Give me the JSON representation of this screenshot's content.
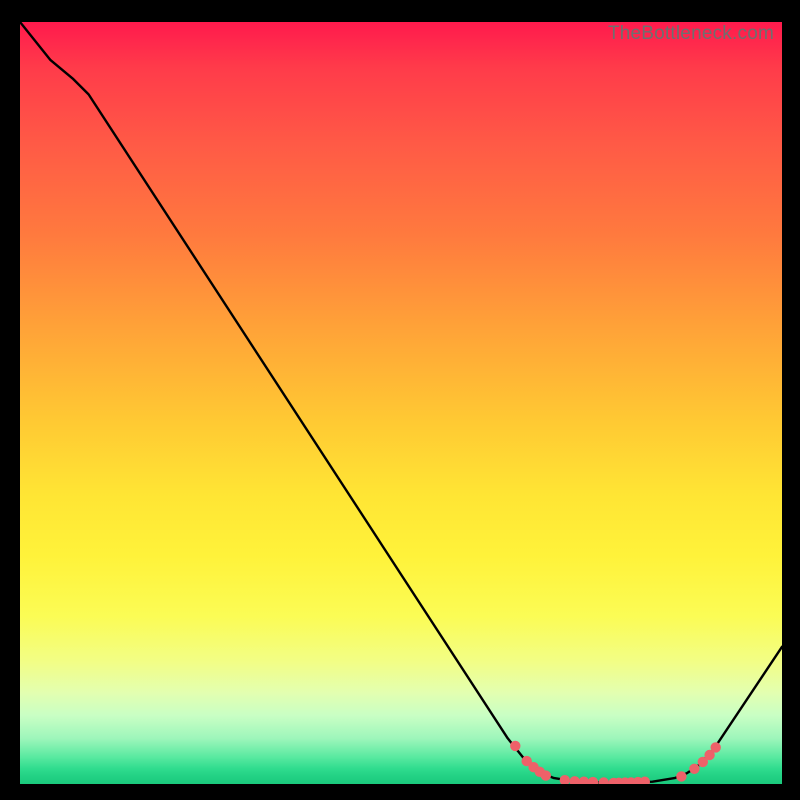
{
  "watermark": "TheBottleneck.com",
  "chart_data": {
    "type": "line",
    "title": "",
    "xlabel": "",
    "ylabel": "",
    "xlim": [
      0,
      100
    ],
    "ylim": [
      0,
      100
    ],
    "background_metric": "bottleneck_severity_gradient_red_to_green",
    "curve": [
      {
        "x": 0,
        "y": 100
      },
      {
        "x": 4,
        "y": 95
      },
      {
        "x": 7,
        "y": 92.5
      },
      {
        "x": 9,
        "y": 90.5
      },
      {
        "x": 64,
        "y": 6
      },
      {
        "x": 66,
        "y": 3.5
      },
      {
        "x": 67,
        "y": 2.6
      },
      {
        "x": 68,
        "y": 1.8
      },
      {
        "x": 69,
        "y": 1.2
      },
      {
        "x": 70,
        "y": 0.8
      },
      {
        "x": 73,
        "y": 0.3
      },
      {
        "x": 78,
        "y": 0.15
      },
      {
        "x": 83,
        "y": 0.3
      },
      {
        "x": 86,
        "y": 0.8
      },
      {
        "x": 87.5,
        "y": 1.4
      },
      {
        "x": 89,
        "y": 2.4
      },
      {
        "x": 91,
        "y": 4.5
      },
      {
        "x": 100,
        "y": 18
      }
    ],
    "markers": [
      {
        "x": 65.0,
        "y": 5.0
      },
      {
        "x": 66.5,
        "y": 3.0
      },
      {
        "x": 67.4,
        "y": 2.2
      },
      {
        "x": 68.2,
        "y": 1.6
      },
      {
        "x": 69.0,
        "y": 1.1
      },
      {
        "x": 71.5,
        "y": 0.5
      },
      {
        "x": 72.8,
        "y": 0.35
      },
      {
        "x": 74.0,
        "y": 0.3
      },
      {
        "x": 75.2,
        "y": 0.25
      },
      {
        "x": 76.6,
        "y": 0.2
      },
      {
        "x": 77.9,
        "y": 0.15
      },
      {
        "x": 78.6,
        "y": 0.16
      },
      {
        "x": 79.4,
        "y": 0.18
      },
      {
        "x": 80.2,
        "y": 0.2
      },
      {
        "x": 81.1,
        "y": 0.25
      },
      {
        "x": 82.0,
        "y": 0.3
      },
      {
        "x": 86.8,
        "y": 1.0
      },
      {
        "x": 88.5,
        "y": 2.0
      },
      {
        "x": 89.6,
        "y": 2.9
      },
      {
        "x": 90.5,
        "y": 3.8
      },
      {
        "x": 91.3,
        "y": 4.8
      }
    ]
  }
}
